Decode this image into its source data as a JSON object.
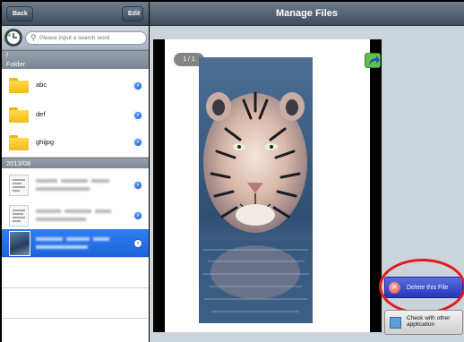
{
  "left_panel": {
    "back_label": "Back",
    "edit_label": "Edit",
    "search": {
      "placeholder": "Please input a search word",
      "value": ""
    },
    "path": "/",
    "folder_section": "Folder",
    "folders": [
      {
        "label": "abc"
      },
      {
        "label": "def"
      },
      {
        "label": "ghijpg"
      }
    ],
    "date_section": "2013/08",
    "files": [
      {
        "kind": "document",
        "selected": false
      },
      {
        "kind": "document",
        "selected": false
      },
      {
        "kind": "image",
        "selected": true
      }
    ]
  },
  "right_panel": {
    "title": "Manage Files",
    "page_indicator": "1 / 1",
    "delete_label": "Delete this File",
    "check_label": "Check with other application"
  },
  "colors": {
    "selection_blue": "#1b63d8",
    "highlight_ring": "#e31b1b",
    "delete_button": "#2734b8"
  }
}
